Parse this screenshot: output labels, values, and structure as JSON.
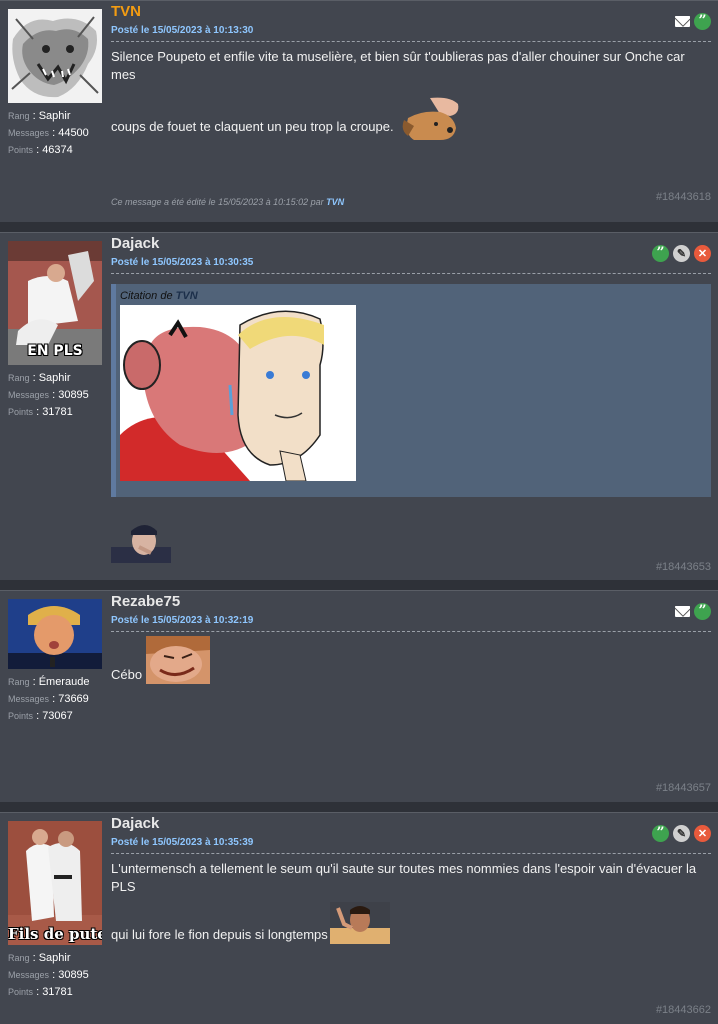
{
  "posts": [
    {
      "author": "TVN",
      "date_label": "Posté le 15/05/2023 à 10:13:30",
      "rank_key": "Rang",
      "rank_value": "Saphir",
      "messages_key": "Messages",
      "messages_value": "44500",
      "points_key": "Points",
      "points_value": "46374",
      "text_line1": "Silence Poupeto et enfile vite ta muselière, et bien sûr t'oublieras pas d'aller chouiner sur Onche car mes",
      "text_line2": "coups de fouet te claquent un peu trop la croupe.",
      "edited_prefix": "Ce message a été édité le 15/05/2023 à 10:15:02 par",
      "edited_author": "TVN",
      "id": "#18443618"
    },
    {
      "author": "Dajack",
      "date_label": "Posté le 15/05/2023 à 10:30:35",
      "avatar_caption": "EN PLS",
      "rank_key": "Rang",
      "rank_value": "Saphir",
      "messages_key": "Messages",
      "messages_value": "30895",
      "points_key": "Points",
      "points_value": "31781",
      "quote_prefix": "Citation de",
      "quote_author": "TVN",
      "id": "#18443653"
    },
    {
      "author": "Rezabe75",
      "date_label": "Posté le 15/05/2023 à 10:32:19",
      "rank_key": "Rang",
      "rank_value": "Émeraude",
      "messages_key": "Messages",
      "messages_value": "73669",
      "points_key": "Points",
      "points_value": "73067",
      "text": "Cébo",
      "id": "#18443657"
    },
    {
      "author": "Dajack",
      "date_label": "Posté le 15/05/2023 à 10:35:39",
      "avatar_caption": "Fils de pute",
      "rank_key": "Rang",
      "rank_value": "Saphir",
      "messages_key": "Messages",
      "messages_value": "30895",
      "points_key": "Points",
      "points_value": "31781",
      "text_line1": "L'untermensch a tellement le seum qu'il saute sur toutes mes nommies dans l'espoir vain d'évacuer la PLS",
      "text_line2": "qui lui fore le fion depuis si longtemps",
      "id": "#18443662"
    }
  ],
  "icons": {
    "mail": "envelope-icon",
    "quote": "quote-icon",
    "edit": "pencil-icon",
    "delete": "close-icon"
  },
  "colors": {
    "background": "#2e3138",
    "post_background": "#42464f",
    "author_highlight": "#f39c12",
    "date": "#8fc7ff",
    "quote_button": "#3ea34f",
    "delete_button": "#e85a3c",
    "quote_box": "#516379"
  }
}
